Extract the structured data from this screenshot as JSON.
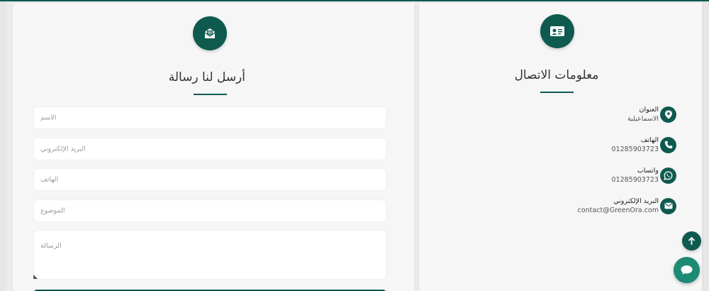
{
  "colors": {
    "accent": "#0f5a4f",
    "chat": "#1d8a74",
    "background": "#ececec",
    "card": "#f6f6f6"
  },
  "message_form": {
    "title": "أرسل لنا رسالة",
    "icon": "envelope-open-icon",
    "fields": {
      "name_placeholder": "الاسم",
      "email_placeholder": "البريد الإلكتروني",
      "phone_placeholder": "الهاتف",
      "subject_placeholder": "الموضوع",
      "message_placeholder": "الرسالة"
    }
  },
  "contact_info": {
    "title": "معلومات الاتصال",
    "icon": "id-card-icon",
    "items": [
      {
        "label": "العنوان",
        "value": "الاسماعيلية",
        "icon": "location-pin-icon"
      },
      {
        "label": "الهاتف",
        "value": "01285903723",
        "icon": "phone-icon"
      },
      {
        "label": "واتساب",
        "value": "01285903723",
        "icon": "whatsapp-icon"
      },
      {
        "label": "البريد الإلكتروني",
        "value": "contact@GreenOra.com",
        "icon": "mail-icon"
      }
    ]
  },
  "floating": {
    "scroll_top_icon": "arrow-up-icon",
    "chat_icon": "chat-bubble-icon"
  }
}
